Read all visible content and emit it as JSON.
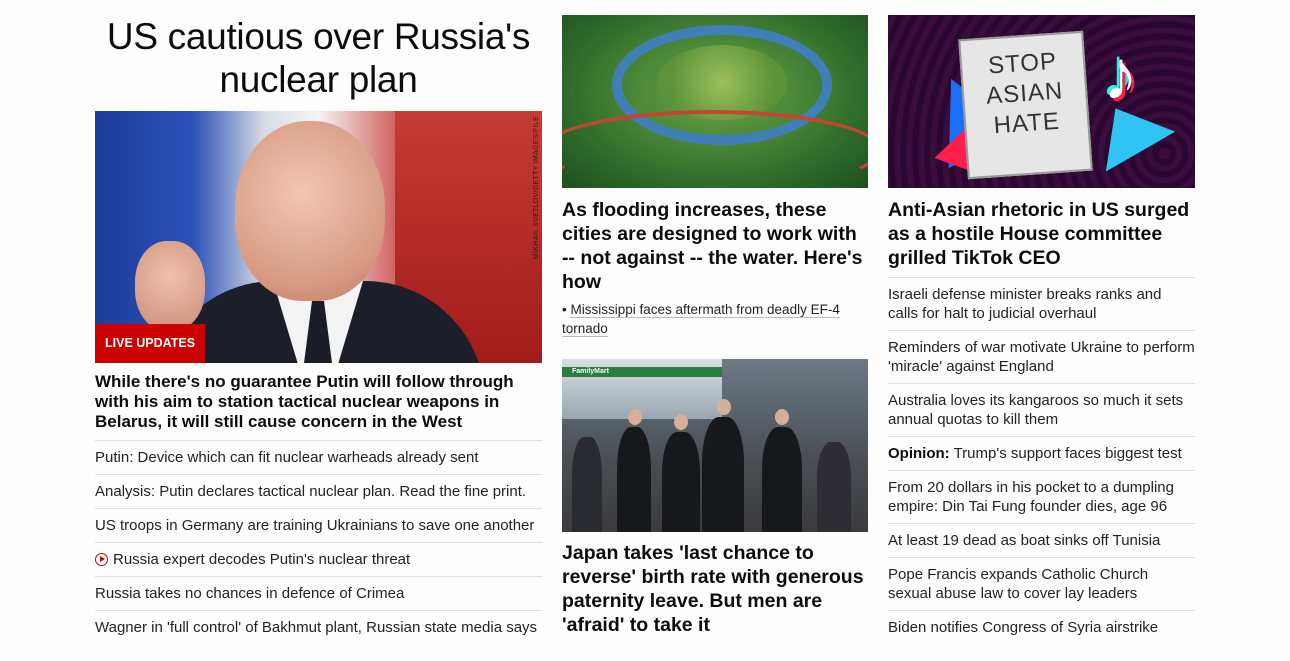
{
  "col1": {
    "title": "US cautious over Russia's nuclear plan",
    "image_credit": "MIKHAIL SVETLOV/GETTY IMAGES/FILE",
    "badge": "LIVE UPDATES",
    "lead": "While there's no guarantee Putin will follow through with his aim to station tactical nuclear weapons in Belarus, it will still cause concern in the West",
    "items": [
      {
        "text": "Putin: Device which can fit nuclear warheads already sent"
      },
      {
        "text": "Analysis: Putin declares tactical nuclear plan. Read the fine print."
      },
      {
        "text": "US troops in Germany are training Ukrainians to save one another"
      },
      {
        "text": "Russia expert decodes Putin's nuclear threat",
        "icon": "play-icon"
      },
      {
        "text": "Russia takes no chances in defence of Crimea"
      },
      {
        "text": "Wagner in 'full control' of Bakhmut plant, Russian state media says"
      }
    ]
  },
  "col2": {
    "story1": {
      "headline": "As flooding increases, these cities are designed to work with -- not against -- the water. Here's how",
      "related": "Mississippi faces aftermath from deadly EF-4 tornado"
    },
    "story2": {
      "headline": "Japan takes 'last chance to reverse' birth rate with generous paternity leave. But men are 'afraid' to take it",
      "store_sign": "FamilyMart"
    }
  },
  "col3": {
    "image_sign": [
      "STOP",
      "ASIAN",
      "HATE"
    ],
    "headline": "Anti-Asian rhetoric in US surged as a hostile House committee grilled TikTok CEO",
    "items": [
      {
        "text": "Israeli defense minister breaks ranks and calls for halt to judicial overhaul"
      },
      {
        "text": "Reminders of war motivate Ukraine to perform 'miracle' against England"
      },
      {
        "text": "Australia loves its kangaroos so much it sets annual quotas to kill them"
      },
      {
        "prefix": "Opinion:",
        "text": "Trump's support faces biggest test"
      },
      {
        "text": "From 20 dollars in his pocket to a dumpling empire: Din Tai Fung founder dies, age 96"
      },
      {
        "text": "At least 19 dead as boat sinks off Tunisia"
      },
      {
        "text": "Pope Francis expands Catholic Church sexual abuse law to cover lay leaders"
      },
      {
        "text": "Biden notifies Congress of Syria airstrike"
      }
    ]
  },
  "colors": {
    "accent": "#cc0000",
    "text": "#0c0c0c",
    "divider": "#e0e0e0"
  }
}
